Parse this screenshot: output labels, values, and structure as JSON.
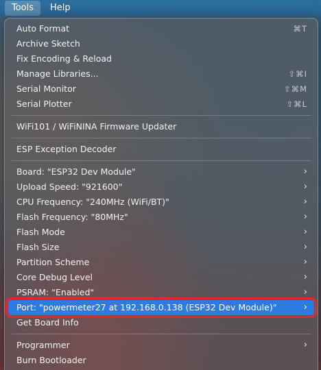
{
  "menubar": {
    "tools": "Tools",
    "help": "Help"
  },
  "menu": {
    "group1": [
      {
        "label": "Auto Format",
        "shortcut": "⌘T"
      },
      {
        "label": "Archive Sketch",
        "shortcut": ""
      },
      {
        "label": "Fix Encoding & Reload",
        "shortcut": ""
      },
      {
        "label": "Manage Libraries...",
        "shortcut": "⇧⌘I"
      },
      {
        "label": "Serial Monitor",
        "shortcut": "⇧⌘M"
      },
      {
        "label": "Serial Plotter",
        "shortcut": "⇧⌘L"
      }
    ],
    "group2": [
      {
        "label": "WiFi101 / WiFiNINA Firmware Updater"
      }
    ],
    "group3": [
      {
        "label": "ESP Exception Decoder"
      }
    ],
    "group4": [
      {
        "label": "Board: \"ESP32 Dev Module\""
      },
      {
        "label": "Upload Speed: \"921600\""
      },
      {
        "label": "CPU Frequency: \"240MHz (WiFi/BT)\""
      },
      {
        "label": "Flash Frequency: \"80MHz\""
      },
      {
        "label": "Flash Mode"
      },
      {
        "label": "Flash Size"
      },
      {
        "label": "Partition Scheme"
      },
      {
        "label": "Core Debug Level"
      },
      {
        "label": "PSRAM: \"Enabled\""
      },
      {
        "label": "Port: \"powermeter27 at 192.168.0.138 (ESP32 Dev Module)\""
      },
      {
        "label": "Get Board Info"
      }
    ],
    "group5": [
      {
        "label": "Programmer"
      },
      {
        "label": "Burn Bootloader"
      }
    ],
    "submenu_icon": "chevron-right-icon",
    "selected_index": 9,
    "colors": {
      "highlight": "#2d7be0",
      "annotation_box": "#e8262b"
    }
  }
}
